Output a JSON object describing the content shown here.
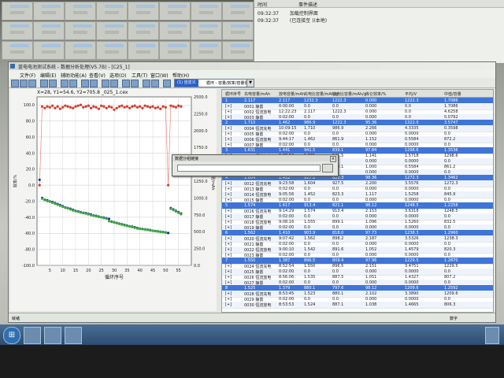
{
  "info_panel": {
    "headers": [
      "时间",
      "事件描述"
    ],
    "rows": [
      {
        "time": "09:32:37",
        "event": "加载控制界面"
      },
      {
        "time": "09:32:37",
        "event": "(已连接至 )(本地)"
      }
    ]
  },
  "window": {
    "title": "蓝电电池测试系统 - 数据分析处理(V5.7B) - [C25_1]",
    "menu": [
      "文件(F)",
      "编辑(E)",
      "辅助功能(A)",
      "查看(V)",
      "选项(O)",
      "工具(T)",
      "窗口(W)",
      "帮助(H)"
    ],
    "selector_tag": "(1) 自定义",
    "selector_value": "循环 - 容量/效率/容量保持"
  },
  "chart": {
    "header": "X=28, Y1=54.6, Y2=705.8  _025_1.cex",
    "y_left_label": "效率/%",
    "y_right_label": "容量/mAh",
    "x_label": "循环序号"
  },
  "chart_data": {
    "type": "scatter",
    "title": "X=28, Y1=54.6, Y2=705.8  _025_1.cex",
    "xlabel": "循环序号",
    "ylabel": "效率/%",
    "y2label": "容量/mAh",
    "xlim": [
      0,
      60
    ],
    "ylim": [
      -100,
      110
    ],
    "y2lim": [
      0,
      2500
    ],
    "x_ticks": [
      5,
      10,
      15,
      20,
      25,
      30,
      35,
      40,
      45,
      50,
      55
    ],
    "y_ticks": [
      100.0,
      80.0,
      60.0,
      40.0,
      20.0,
      0.0,
      -20.0,
      -40.0,
      -60.0,
      -80.0,
      -100.0
    ],
    "y2_ticks": [
      2500.0,
      2250.0,
      2000.0,
      1750.0,
      1500.0,
      1250.0,
      1000.0,
      750.0,
      500.0,
      250.0,
      0.0
    ],
    "grid": true,
    "series": [
      {
        "color": "#d63b2e",
        "axis": "left",
        "x": [
          1,
          2,
          3,
          4,
          5,
          6,
          7,
          8,
          9,
          10,
          11,
          12,
          13,
          14,
          15,
          16,
          17,
          18,
          19,
          20,
          21,
          22,
          23,
          24,
          25,
          26,
          27,
          28,
          29,
          30,
          31,
          32,
          33,
          34,
          35,
          36,
          37,
          38,
          39,
          40,
          41,
          42,
          43,
          44,
          45,
          46,
          47,
          48,
          49,
          50,
          51,
          52,
          53,
          54,
          55,
          56
        ],
        "values": [
          0,
          98,
          96,
          98,
          97,
          99,
          96,
          98,
          95,
          97,
          99,
          98,
          97,
          96,
          98,
          99,
          100,
          97,
          98,
          99,
          96,
          98,
          97,
          95,
          99,
          98,
          96,
          98,
          97,
          94,
          96,
          98,
          99,
          97,
          98,
          96,
          98,
          99,
          97,
          98,
          96,
          99,
          98,
          97,
          98,
          96,
          97,
          95,
          98,
          97,
          0,
          99,
          98,
          97,
          99,
          98
        ]
      },
      {
        "color": "#1e2aa8",
        "axis": "right",
        "x": [
          1,
          2,
          3,
          4,
          5,
          6,
          7,
          8,
          9,
          10,
          11,
          12,
          13,
          14,
          15,
          16,
          17,
          18,
          19,
          20,
          21,
          22,
          23,
          24,
          25,
          26,
          27,
          28,
          29,
          30,
          31,
          32,
          33,
          34,
          35,
          36,
          37,
          38,
          39,
          40,
          41,
          42,
          43,
          44,
          45,
          46,
          47,
          48,
          49,
          50,
          51,
          52,
          53,
          54,
          55,
          56
        ],
        "values": [
          1270,
          1000,
          975,
          965,
          950,
          940,
          925,
          910,
          895,
          880,
          860,
          850,
          840,
          825,
          810,
          800,
          790,
          780,
          775,
          765,
          755,
          740,
          735,
          725,
          715,
          710,
          700,
          690,
          650,
          640,
          630,
          620,
          610,
          600,
          590,
          580,
          575,
          565,
          555,
          545,
          540,
          535,
          530,
          525,
          515,
          510,
          505,
          500,
          495,
          490,
          480,
          850,
          830,
          810,
          790,
          770
        ]
      },
      {
        "color": "#3aa83a",
        "axis": "right",
        "x": [
          2,
          3,
          4,
          5,
          6,
          7,
          8,
          9,
          10,
          11,
          12,
          13,
          14,
          15,
          16,
          17,
          18,
          19,
          20,
          21,
          22,
          23,
          24,
          25,
          26,
          27,
          28,
          29,
          30,
          31,
          32,
          33,
          34,
          35,
          36,
          37,
          38,
          39,
          40,
          41,
          42,
          43,
          44,
          45,
          46,
          47,
          48,
          49,
          50,
          52,
          53,
          54,
          55,
          56
        ],
        "values": [
          990,
          970,
          955,
          945,
          930,
          915,
          900,
          885,
          870,
          855,
          845,
          830,
          815,
          805,
          795,
          785,
          775,
          768,
          758,
          745,
          738,
          728,
          718,
          712,
          702,
          692,
          655,
          645,
          635,
          625,
          615,
          605,
          595,
          585,
          578,
          568,
          558,
          548,
          542,
          537,
          532,
          527,
          518,
          512,
          507,
          502,
          497,
          492,
          486,
          840,
          820,
          800,
          780,
          760
        ]
      }
    ]
  },
  "table": {
    "headers": [
      "循环序号",
      "充电容量/mAh",
      "放电容量/mAh",
      "充电比容量/mAh/g",
      "放电比容量/mAh/g",
      "库仑效率/%",
      "平均/V",
      "中值/容量"
    ],
    "rows": [
      {
        "type": "cyc",
        "c": [
          "1",
          "2.117",
          "2.117",
          "1232.3",
          "1222.3",
          "0.000",
          "1222.3",
          "1.7086"
        ]
      },
      {
        "type": "step",
        "c": [
          "[+]",
          "0001 静置",
          "0:00:00",
          "0.0",
          "0.0",
          "0.000",
          "0.0",
          "1.7086"
        ]
      },
      {
        "type": "step",
        "c": [
          "[+]",
          "0002 恒流放电",
          "12:22:23",
          "2.117",
          "1222.3",
          "0.000",
          "0.0",
          "4.6258"
        ]
      },
      {
        "type": "step",
        "c": [
          "[+]",
          "0003 静置",
          "0:02:00",
          "0.0",
          "0.0",
          "0.000",
          "0.0",
          "0.0792"
        ]
      },
      {
        "type": "cyc",
        "c": [
          "2",
          "1.710",
          "1.462",
          "986.9",
          "1222.3",
          "95.36",
          "1322.0",
          "3.5747"
        ]
      },
      {
        "type": "step",
        "c": [
          "[+]",
          "0004 恒流充电",
          "10:09:15",
          "1.710",
          "986.9",
          "2.266",
          "4.3335",
          "0.3598"
        ]
      },
      {
        "type": "step",
        "c": [
          "[+]",
          "0005 静置",
          "0:02:00",
          "0.0",
          "0.0",
          "0.000",
          "0.0000",
          "0.0"
        ]
      },
      {
        "type": "step",
        "c": [
          "[+]",
          "0006 恒流放电",
          "9:44:17",
          "1.462",
          "861.9",
          "1.152",
          "0.5584",
          "872.2"
        ]
      },
      {
        "type": "step",
        "c": [
          "[+]",
          "0007 静置",
          "0:02:00",
          "0.0",
          "0.0",
          "0.000",
          "0.0000",
          "0.0"
        ]
      },
      {
        "type": "cyc",
        "c": [
          "3",
          "1.631",
          "1.441",
          "941.5",
          "839.1",
          "97.84",
          "1298.6",
          "1.3536"
        ]
      },
      {
        "type": "step",
        "c": [
          "[+]",
          "0008 恒流充电",
          "9:38:50",
          "1.631",
          "941.5",
          "1.141",
          "1.5718",
          "1298.6"
        ]
      },
      {
        "type": "step",
        "c": [
          "[+]",
          "0009 静置",
          "0:02:00",
          "0.0",
          "0.0",
          "0.000",
          "0.0000",
          "0.0"
        ]
      },
      {
        "type": "step",
        "c": [
          "[+]",
          "0010 恒流放电",
          "9:08:17",
          "1.441",
          "839.1",
          "1.000",
          "0.5584",
          "861.2"
        ]
      },
      {
        "type": "step",
        "c": [
          "[+]",
          "0011 静置",
          "0:02:00",
          "0.0",
          "0.0",
          "0.000",
          "0.0000",
          "0.0"
        ]
      },
      {
        "type": "cyc",
        "c": [
          "4",
          "1.604",
          "1.452",
          "927.5",
          "823.3",
          "98.36",
          "1272.3",
          "1.3462"
        ]
      },
      {
        "type": "step",
        "c": [
          "[+]",
          "0012 恒流充电",
          "9:23:58",
          "1.604",
          "927.5",
          "2.200",
          "3.5576",
          "1272.3"
        ]
      },
      {
        "type": "step",
        "c": [
          "[+]",
          "0013 静置",
          "0:02:00",
          "0.0",
          "0.0",
          "0.000",
          "0.0000",
          "0.0"
        ]
      },
      {
        "type": "step",
        "c": [
          "[+]",
          "0014 恒流放电",
          "9:05:56",
          "1.452",
          "823.3",
          "1.117",
          "1.5258",
          "845.9"
        ]
      },
      {
        "type": "step",
        "c": [
          "[+]",
          "0015 静置",
          "0:02:00",
          "0.0",
          "0.0",
          "0.000",
          "0.0000",
          "0.0"
        ]
      },
      {
        "type": "cyc",
        "c": [
          "5",
          "1.574",
          "1.417",
          "913.4",
          "821.1",
          "98.12",
          "1248.5",
          "1.2258"
        ]
      },
      {
        "type": "step",
        "c": [
          "[+]",
          "0016 恒流充电",
          "9:14:29",
          "1.574",
          "913.4",
          "2.153",
          "3.6318",
          "1248.5"
        ]
      },
      {
        "type": "step",
        "c": [
          "[+]",
          "0017 静置",
          "0:02:00",
          "0.0",
          "0.0",
          "0.000",
          "0.0000",
          "0.0"
        ]
      },
      {
        "type": "step",
        "c": [
          "[+]",
          "0018 恒流放电",
          "9:08:16",
          "1.555",
          "899.1",
          "1.096",
          "1.5260",
          "832.5"
        ]
      },
      {
        "type": "step",
        "c": [
          "[+]",
          "0019 静置",
          "0:02:00",
          "0.0",
          "0.0",
          "0.000",
          "0.0000",
          "0.0"
        ]
      },
      {
        "type": "cyc",
        "c": [
          "6",
          "1.562",
          "1.410",
          "903.9",
          "818.0",
          "97.73",
          "1238.3",
          "1.2960"
        ]
      },
      {
        "type": "step",
        "c": [
          "[+]",
          "0020 恒流充电",
          "9:07:42",
          "1.562",
          "898.2",
          "2.187",
          "3.5326",
          "1238.3"
        ]
      },
      {
        "type": "step",
        "c": [
          "[+]",
          "0021 静置",
          "0:02:00",
          "0.0",
          "0.0",
          "0.000",
          "0.0000",
          "0.0"
        ]
      },
      {
        "type": "step",
        "c": [
          "[+]",
          "0022 恒流放电",
          "9:00:10",
          "1.542",
          "891.6",
          "1.052",
          "1.4579",
          "820.3"
        ]
      },
      {
        "type": "step",
        "c": [
          "[+]",
          "0023 静置",
          "0:02:00",
          "0.0",
          "0.0",
          "0.000",
          "0.0000",
          "0.0"
        ]
      },
      {
        "type": "cyc",
        "c": [
          "7",
          "1.550",
          "1.387",
          "896.5",
          "809.4",
          "97.96",
          "1229.5",
          "1.2870"
        ]
      },
      {
        "type": "step",
        "c": [
          "[+]",
          "0024 恒流充电",
          "8:52:54",
          "1.550",
          "896.5",
          "2.151",
          "3.4751",
          "1229.5"
        ]
      },
      {
        "type": "step",
        "c": [
          "[+]",
          "0025 静置",
          "0:02:00",
          "0.0",
          "0.0",
          "0.000",
          "0.0000",
          "0.0"
        ]
      },
      {
        "type": "step",
        "c": [
          "[+]",
          "0026 恒流放电",
          "8:56:06",
          "1.535",
          "887.5",
          "1.051",
          "1.4327",
          "807.2"
        ]
      },
      {
        "type": "step",
        "c": [
          "[+]",
          "0027 静置",
          "0:02:00",
          "0.0",
          "0.0",
          "0.000",
          "0.0000",
          "0.0"
        ]
      },
      {
        "type": "cyc",
        "c": [
          "8",
          "1.525",
          "1.379",
          "880.1",
          "797.6",
          "98.12",
          "1209.6",
          "1.2592"
        ]
      },
      {
        "type": "step",
        "c": [
          "[+]",
          "0028 恒流充电",
          "8:53:45",
          "1.523",
          "880.1",
          "2.102",
          "3.3890",
          "1209.6"
        ]
      },
      {
        "type": "step",
        "c": [
          "[+]",
          "0029 静置",
          "0:02:00",
          "0.0",
          "0.0",
          "0.000",
          "0.0000",
          "0.0"
        ]
      },
      {
        "type": "step",
        "c": [
          "[+]",
          "0030 恒流放电",
          "8:53:53",
          "1.524",
          "887.1",
          "1.038",
          "1.4665",
          "806.3"
        ]
      }
    ]
  },
  "dialog": {
    "title": "数据分组链接"
  },
  "status": {
    "left": "就绪",
    "right": "数字"
  }
}
